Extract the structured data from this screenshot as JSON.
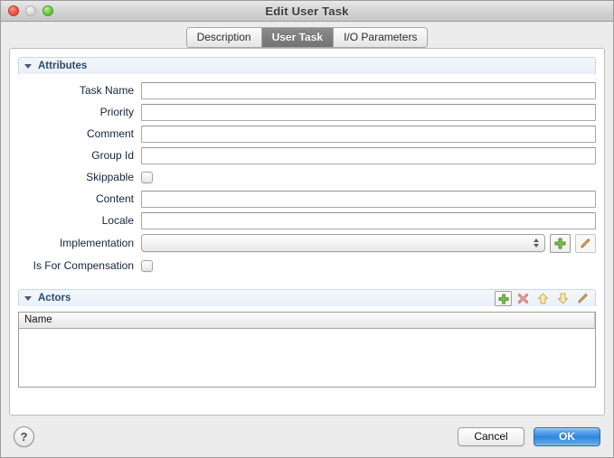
{
  "window": {
    "title": "Edit User Task",
    "controls": {
      "close": "close-button",
      "minimize": "minimize-button",
      "zoom": "zoom-button"
    }
  },
  "tabs": [
    {
      "label": "Description",
      "active": false
    },
    {
      "label": "User Task",
      "active": true
    },
    {
      "label": "I/O Parameters",
      "active": false
    }
  ],
  "attributes_section": {
    "title": "Attributes",
    "expanded": true,
    "fields": [
      {
        "label": "Task Name",
        "type": "text",
        "value": ""
      },
      {
        "label": "Priority",
        "type": "text",
        "value": ""
      },
      {
        "label": "Comment",
        "type": "text",
        "value": ""
      },
      {
        "label": "Group Id",
        "type": "text",
        "value": ""
      },
      {
        "label": "Skippable",
        "type": "checkbox",
        "checked": false
      },
      {
        "label": "Content",
        "type": "text",
        "value": ""
      },
      {
        "label": "Locale",
        "type": "text",
        "value": ""
      },
      {
        "label": "Implementation",
        "type": "combo",
        "value": ""
      },
      {
        "label": "Is For Compensation",
        "type": "checkbox",
        "checked": false
      }
    ],
    "implementation_buttons": [
      {
        "name": "add",
        "icon": "plus-icon"
      },
      {
        "name": "edit",
        "icon": "pencil-icon"
      }
    ]
  },
  "actors_section": {
    "title": "Actors",
    "expanded": true,
    "toolbar": [
      {
        "name": "add",
        "icon": "plus-icon",
        "enabled": true
      },
      {
        "name": "delete",
        "icon": "x-icon",
        "enabled": false
      },
      {
        "name": "move-up",
        "icon": "arrow-up-icon",
        "enabled": false
      },
      {
        "name": "move-down",
        "icon": "arrow-down-icon",
        "enabled": false
      },
      {
        "name": "edit",
        "icon": "pencil-icon",
        "enabled": false
      }
    ],
    "table": {
      "columns": [
        "Name"
      ],
      "rows": []
    }
  },
  "footer": {
    "help_label": "?",
    "cancel_label": "Cancel",
    "ok_label": "OK"
  },
  "colors": {
    "accent": "#2e86e0",
    "section_title": "#2e4a6b",
    "tab_active_bg": "#7d7d7d"
  }
}
